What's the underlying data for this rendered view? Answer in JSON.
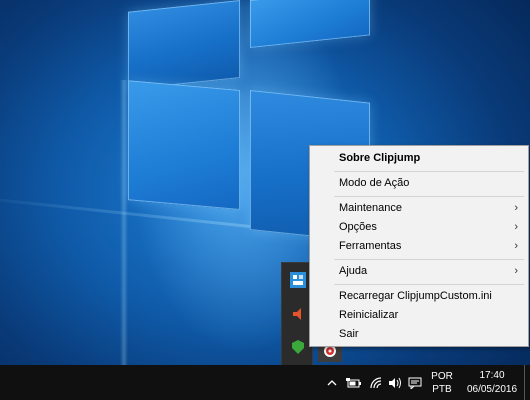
{
  "context_menu": {
    "items": [
      {
        "label": "Sobre Clipjump",
        "bold": true
      },
      {
        "label": "Modo de Ação"
      },
      {
        "label": "Maintenance",
        "submenu": true
      },
      {
        "label": "Opções",
        "submenu": true
      },
      {
        "label": "Ferramentas",
        "submenu": true
      },
      {
        "label": "Ajuda",
        "submenu": true
      },
      {
        "label": "Recarregar ClipjumpCustom.ini"
      },
      {
        "label": "Reinicializar"
      },
      {
        "label": "Sair"
      }
    ],
    "submenu_glyph": "›"
  },
  "taskbar": {
    "language_line1": "POR",
    "language_line2": "PTB",
    "time": "17:40",
    "date": "06/05/2016",
    "tray_icons": [
      "chevron-up-icon",
      "battery-icon",
      "wifi-icon",
      "volume-icon",
      "action-center-icon"
    ]
  },
  "tray_overflow": {
    "icons": [
      "app-icon",
      "speaker-icon",
      "shield-icon",
      "clipjump-icon"
    ]
  },
  "colors": {
    "taskbar": "#101010",
    "menu_bg": "#f2f2f2",
    "wallpaper_blue": "#1f7fd6"
  }
}
